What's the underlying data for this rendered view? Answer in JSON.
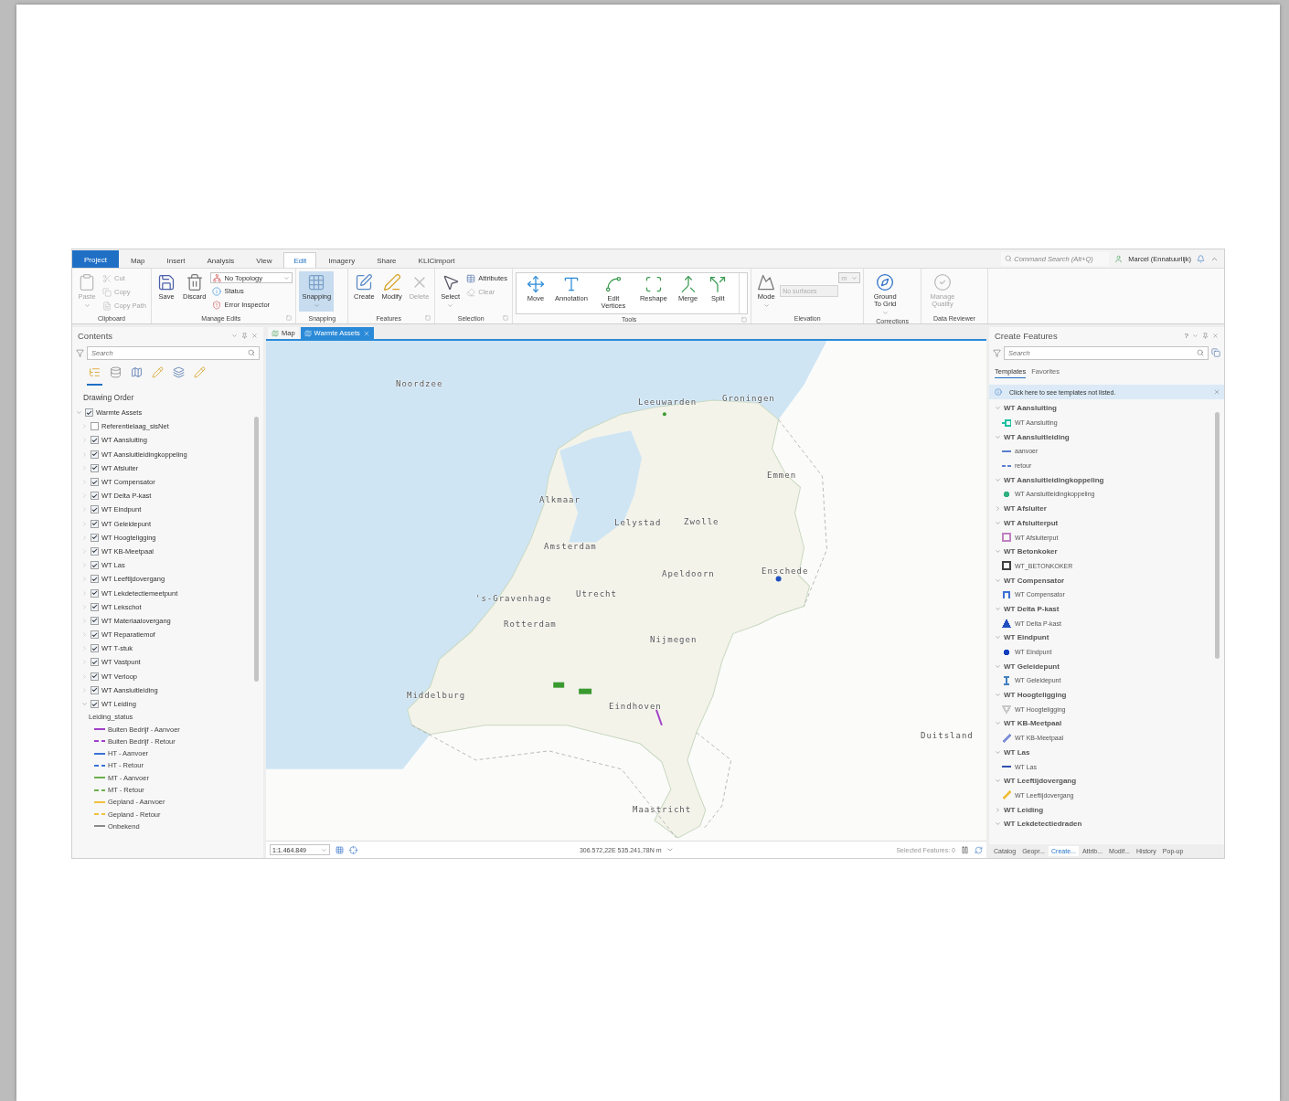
{
  "ribbon_tabs": [
    {
      "label": "Project",
      "kind": "backstage",
      "selected": false
    },
    {
      "label": "Map",
      "kind": "tab",
      "selected": false
    },
    {
      "label": "Insert",
      "kind": "tab",
      "selected": false
    },
    {
      "label": "Analysis",
      "kind": "tab",
      "selected": false
    },
    {
      "label": "View",
      "kind": "tab",
      "selected": false
    },
    {
      "label": "Edit",
      "kind": "tab",
      "selected": true
    },
    {
      "label": "Imagery",
      "kind": "tab",
      "selected": false
    },
    {
      "label": "Share",
      "kind": "tab",
      "selected": false
    },
    {
      "label": "KLICimport",
      "kind": "tab",
      "selected": false
    }
  ],
  "command_search": {
    "placeholder": "Command Search (Alt+Q)"
  },
  "user": "Marcel (Ennatuurlijk)",
  "ribbon_groups": [
    {
      "title": "Clipboard",
      "launcher": false,
      "gallery": false,
      "items": [
        {
          "kind": "large",
          "label": "Paste",
          "disabled": true,
          "menu": true,
          "selected": false
        },
        {
          "kind": "stack",
          "buttons": [
            {
              "kind": "small",
              "label": "Cut",
              "disabled": true
            },
            {
              "kind": "small",
              "label": "Copy",
              "disabled": true
            },
            {
              "kind": "small",
              "label": "Copy Path",
              "disabled": true
            }
          ]
        }
      ]
    },
    {
      "title": "Manage Edits",
      "launcher": true,
      "gallery": false,
      "items": [
        {
          "kind": "large",
          "label": "Save",
          "disabled": false,
          "menu": false,
          "selected": false
        },
        {
          "kind": "large",
          "label": "Discard",
          "disabled": false,
          "menu": false,
          "selected": false
        },
        {
          "kind": "stack",
          "buttons": [
            {
              "kind": "select",
              "value": "No Topology",
              "disabled": false
            },
            {
              "kind": "small",
              "label": "Status",
              "disabled": false
            },
            {
              "kind": "small",
              "label": "Error Inspector",
              "disabled": false
            }
          ]
        }
      ]
    },
    {
      "title": "Snapping",
      "launcher": false,
      "gallery": false,
      "items": [
        {
          "kind": "large",
          "label": "Snapping",
          "disabled": false,
          "menu": true,
          "selected": true
        }
      ]
    },
    {
      "title": "Features",
      "launcher": true,
      "gallery": false,
      "items": [
        {
          "kind": "large",
          "label": "Create",
          "disabled": false,
          "menu": false,
          "selected": false
        },
        {
          "kind": "large",
          "label": "Modify",
          "disabled": false,
          "menu": false,
          "selected": false
        },
        {
          "kind": "large",
          "label": "Delete",
          "disabled": true,
          "menu": false,
          "selected": false
        }
      ]
    },
    {
      "title": "Selection",
      "launcher": true,
      "gallery": false,
      "items": [
        {
          "kind": "large",
          "label": "Select",
          "disabled": false,
          "menu": true,
          "selected": false
        },
        {
          "kind": "stack",
          "buttons": [
            {
              "kind": "small",
              "label": "Attributes",
              "disabled": false
            },
            {
              "kind": "small",
              "label": "Clear",
              "disabled": true
            }
          ]
        }
      ]
    },
    {
      "title": "Tools",
      "launcher": true,
      "gallery": true,
      "items": [
        {
          "kind": "large",
          "label": "Move",
          "disabled": false,
          "menu": false,
          "selected": false
        },
        {
          "kind": "large",
          "label": "Annotation",
          "disabled": false,
          "menu": false,
          "selected": false
        },
        {
          "kind": "large",
          "label": "Edit Vertices",
          "disabled": false,
          "menu": false,
          "selected": false
        },
        {
          "kind": "large",
          "label": "Reshape",
          "disabled": false,
          "menu": false,
          "selected": false
        },
        {
          "kind": "large",
          "label": "Merge",
          "disabled": false,
          "menu": false,
          "selected": false
        },
        {
          "kind": "large",
          "label": "Split",
          "disabled": false,
          "menu": false,
          "selected": false
        }
      ]
    },
    {
      "title": "Elevation",
      "launcher": false,
      "gallery": false,
      "items": [
        {
          "kind": "large",
          "label": "Mode",
          "disabled": false,
          "menu": true,
          "selected": false
        },
        {
          "kind": "stack",
          "buttons": [
            {
              "kind": "select",
              "value": "m",
              "disabled": true
            },
            {
              "kind": "field",
              "placeholder": "No surfaces",
              "disabled": true
            }
          ]
        }
      ]
    },
    {
      "title": "Corrections",
      "launcher": false,
      "gallery": false,
      "items": [
        {
          "kind": "large",
          "label": "Ground To Grid",
          "disabled": false,
          "menu": true,
          "selected": false
        }
      ]
    },
    {
      "title": "Data Reviewer",
      "launcher": false,
      "gallery": false,
      "items": [
        {
          "kind": "large",
          "label": "Manage Quality",
          "disabled": true,
          "menu": false,
          "selected": false
        }
      ]
    }
  ],
  "contents": {
    "title": "Contents",
    "search": {
      "placeholder": "Search"
    },
    "view_tabs": [
      {
        "selected": true
      },
      {
        "selected": false
      },
      {
        "selected": false
      },
      {
        "selected": false
      },
      {
        "selected": false
      },
      {
        "selected": false
      }
    ],
    "heading": "Drawing Order",
    "tree": [
      {
        "label": "Warmte Assets",
        "checked": true,
        "expanded": true,
        "children": [
          {
            "label": "Referentielaag_sisNet",
            "checked": false,
            "expanded": false
          },
          {
            "label": "WT Aansluiting",
            "checked": true,
            "expanded": false
          },
          {
            "label": "WT Aansluitleidingkoppeling",
            "checked": true,
            "expanded": false
          },
          {
            "label": "WT Afsluiter",
            "checked": true,
            "expanded": false
          },
          {
            "label": "WT Compensator",
            "checked": true,
            "expanded": false
          },
          {
            "label": "WT Delta P-kast",
            "checked": true,
            "expanded": false
          },
          {
            "label": "WT Eindpunt",
            "checked": true,
            "expanded": false
          },
          {
            "label": "WT Geleidepunt",
            "checked": true,
            "expanded": false
          },
          {
            "label": "WT Hoogteligging",
            "checked": true,
            "expanded": false
          },
          {
            "label": "WT KB-Meetpaal",
            "checked": true,
            "expanded": false
          },
          {
            "label": "WT Las",
            "checked": true,
            "expanded": false
          },
          {
            "label": "WT Leeftijdovergang",
            "checked": true,
            "expanded": false
          },
          {
            "label": "WT Lekdetectiemeetpunt",
            "checked": true,
            "expanded": false
          },
          {
            "label": "WT Lekschot",
            "checked": true,
            "expanded": false
          },
          {
            "label": "WT Materiaalovergang",
            "checked": true,
            "expanded": false
          },
          {
            "label": "WT Reparatiemof",
            "checked": true,
            "expanded": false
          },
          {
            "label": "WT T-stuk",
            "checked": true,
            "expanded": false
          },
          {
            "label": "WT Vastpunt",
            "checked": true,
            "expanded": false
          },
          {
            "label": "WT Verloop",
            "checked": true,
            "expanded": false
          },
          {
            "label": "WT Aansluitleiding",
            "checked": true,
            "expanded": false
          },
          {
            "label": "WT Leiding",
            "checked": true,
            "expanded": true,
            "legend": {
              "field": "Leiding_status",
              "classes": [
                {
                  "label": "Buiten Bedrijf - Aanvoer",
                  "color": "#a040c8",
                  "kind": "solid"
                },
                {
                  "label": "Buiten Bedrijf - Retour",
                  "color": "#a040c8",
                  "kind": "dashed"
                },
                {
                  "label": "HT - Aanvoer",
                  "color": "#3a72d8",
                  "kind": "solid"
                },
                {
                  "label": "HT - Retour",
                  "color": "#3a72d8",
                  "kind": "dashed"
                },
                {
                  "label": "MT - Aanvoer",
                  "color": "#6ab04c",
                  "kind": "solid"
                },
                {
                  "label": "MT - Retour",
                  "color": "#6ab04c",
                  "kind": "dashed"
                },
                {
                  "label": "Gepland - Aanvoer",
                  "color": "#f0c040",
                  "kind": "solid"
                },
                {
                  "label": "Gepland - Retour",
                  "color": "#f0c040",
                  "kind": "dashed"
                },
                {
                  "label": "Onbekend",
                  "color": "#8a8a8a",
                  "kind": "solid"
                }
              ]
            }
          }
        ]
      }
    ]
  },
  "map_tabs": [
    {
      "label": "Map",
      "selected": false,
      "closable": false
    },
    {
      "label": "Warmte Assets",
      "selected": true,
      "closable": true
    }
  ],
  "map_labels": [
    "Noordzee",
    "Leeuwarden",
    "Groningen",
    "Emmen",
    "Alkmaar",
    "Lelystad",
    "Zwolle",
    "Amsterdam",
    "Apeldoorn",
    "Enschede",
    "'s-Gravenhage",
    "Utrecht",
    "Rotterdam",
    "Nijmegen",
    "Middelburg",
    "Eindhoven",
    "Duitsland",
    "Maastricht"
  ],
  "map_status": {
    "scale": "1:1.464.849",
    "coordinates": "306.572,22E 535.241,78N m",
    "selected_features": "Selected Features: 0"
  },
  "create_features": {
    "title": "Create Features",
    "help": "?",
    "search": {
      "placeholder": "Search"
    },
    "tabs": [
      {
        "label": "Templates",
        "selected": true
      },
      {
        "label": "Favorites",
        "selected": false
      }
    ],
    "info": "Click here to see templates not listed.",
    "groups": [
      {
        "name": "WT Aansluiting",
        "expanded": true,
        "templates": [
          {
            "label": "WT Aansluiting",
            "kind": "connector",
            "color": "#20c0a0"
          }
        ]
      },
      {
        "name": "WT Aansluitleiding",
        "expanded": true,
        "templates": [
          {
            "label": "aanvoer",
            "kind": "line",
            "color": "#5a7fd0"
          },
          {
            "label": "retour",
            "kind": "dashed",
            "color": "#5a7fd0"
          }
        ]
      },
      {
        "name": "WT Aansluitleidingkoppeling",
        "expanded": true,
        "templates": [
          {
            "label": "WT Aansluitleidingkoppeling",
            "kind": "dot",
            "color": "#30b080"
          }
        ]
      },
      {
        "name": "WT Afsluiter",
        "expanded": false
      },
      {
        "name": "WT Afsluiterput",
        "expanded": true,
        "templates": [
          {
            "label": "WT Afsluiterput",
            "kind": "square",
            "color": "#c080c0"
          }
        ]
      },
      {
        "name": "WT Betonkoker",
        "expanded": true,
        "templates": [
          {
            "label": "WT_BETONKOKER",
            "kind": "square",
            "color": "#404040"
          }
        ]
      },
      {
        "name": "WT Compensator",
        "expanded": true,
        "templates": [
          {
            "label": "WT Compensator",
            "kind": "bracket",
            "color": "#3a6fd8"
          }
        ]
      },
      {
        "name": "WT Delta P-kast",
        "expanded": true,
        "templates": [
          {
            "label": "WT Delta P-kast",
            "kind": "triangle",
            "color": "#2050c0"
          }
        ]
      },
      {
        "name": "WT Eindpunt",
        "expanded": true,
        "templates": [
          {
            "label": "WT Eindpunt",
            "kind": "dot",
            "color": "#1040c0"
          }
        ]
      },
      {
        "name": "WT Geleidepunt",
        "expanded": true,
        "templates": [
          {
            "label": "WT Geleidepunt",
            "kind": "marker",
            "color": "#4080c0"
          }
        ]
      },
      {
        "name": "WT Hoogteligging",
        "expanded": true,
        "templates": [
          {
            "label": "WT Hoogteligging",
            "kind": "triangle-outline",
            "color": "#c8c8c8"
          }
        ]
      },
      {
        "name": "WT KB-Meetpaal",
        "expanded": true,
        "templates": [
          {
            "label": "WT KB-Meetpaal",
            "kind": "slash",
            "color": "#8090d8"
          }
        ]
      },
      {
        "name": "WT Las",
        "expanded": true,
        "templates": [
          {
            "label": "WT Las",
            "kind": "line",
            "color": "#3050b0"
          }
        ]
      },
      {
        "name": "WT Leeftijdovergang",
        "expanded": true,
        "templates": [
          {
            "label": "WT Leeftijdovergang",
            "kind": "slash",
            "color": "#f0c040"
          }
        ]
      },
      {
        "name": "WT Leiding",
        "expanded": false
      },
      {
        "name": "WT Lekdetectiedraden",
        "expanded": true
      }
    ]
  },
  "dock_tabs": [
    {
      "label": "Catalog",
      "selected": false
    },
    {
      "label": "Geopr...",
      "selected": false
    },
    {
      "label": "Create...",
      "selected": true
    },
    {
      "label": "Attrib...",
      "selected": false
    },
    {
      "label": "Modif...",
      "selected": false
    },
    {
      "label": "History",
      "selected": false
    },
    {
      "label": "Pop-up",
      "selected": false
    }
  ]
}
